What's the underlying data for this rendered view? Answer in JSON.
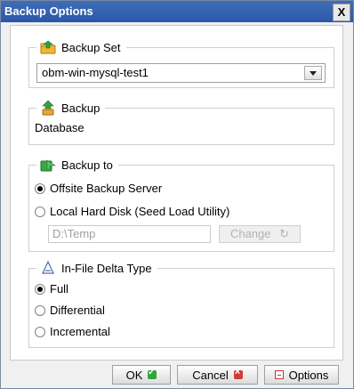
{
  "window": {
    "title": "Backup Options",
    "close_label": "X"
  },
  "backup_set": {
    "legend": "Backup Set",
    "selected": "obm-win-mysql-test1"
  },
  "backup": {
    "legend": "Backup",
    "value": "Database"
  },
  "backup_to": {
    "legend": "Backup to",
    "options": [
      {
        "label": "Offsite Backup Server",
        "checked": true
      },
      {
        "label": "Local Hard Disk (Seed Load Utility)",
        "checked": false
      }
    ],
    "path": "D:\\Temp",
    "change_label": "Change"
  },
  "delta": {
    "legend": "In-File Delta Type",
    "options": [
      {
        "label": "Full",
        "checked": true
      },
      {
        "label": "Differential",
        "checked": false
      },
      {
        "label": "Incremental",
        "checked": false
      }
    ]
  },
  "footer": {
    "ok_label": "OK",
    "cancel_label": "Cancel",
    "options_label": "Options"
  }
}
